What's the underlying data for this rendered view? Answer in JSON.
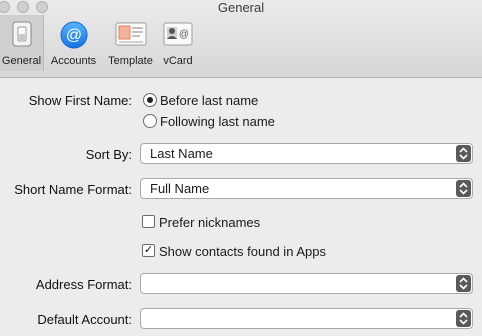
{
  "window": {
    "title": "General"
  },
  "toolbar": {
    "tabs": [
      {
        "label": "General"
      },
      {
        "label": "Accounts"
      },
      {
        "label": "Template"
      },
      {
        "label": "vCard"
      }
    ]
  },
  "form": {
    "show_first_name": {
      "label": "Show First Name:",
      "options": [
        "Before last name",
        "Following last name"
      ],
      "selected": "Before last name"
    },
    "sort_by": {
      "label": "Sort By:",
      "value": "Last Name"
    },
    "short_name_format": {
      "label": "Short Name Format:",
      "value": "Full Name"
    },
    "prefer_nicknames": {
      "label": "Prefer nicknames",
      "checked": false
    },
    "show_contacts_in_apps": {
      "label": "Show contacts found in Apps",
      "checked": true
    },
    "address_format": {
      "label": "Address Format:",
      "value": ""
    },
    "default_account": {
      "label": "Default Account:",
      "value": ""
    }
  }
}
